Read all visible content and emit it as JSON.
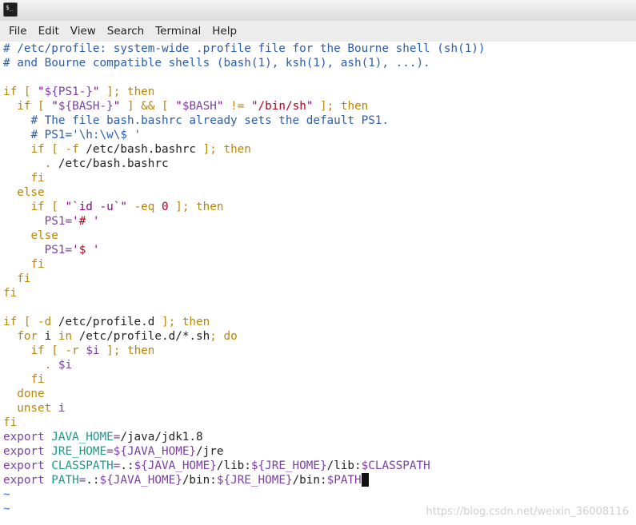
{
  "menu": [
    "File",
    "Edit",
    "View",
    "Search",
    "Terminal",
    "Help"
  ],
  "icon": "terminal-icon",
  "icon_glyph": "$_",
  "lines": [
    [
      [
        "comment",
        "# /etc/profile: system-wide .profile file for the Bourne shell (sh(1))"
      ]
    ],
    [
      [
        "comment",
        "# and Bourne compatible shells (bash(1), ksh(1), ash(1), ...)."
      ]
    ],
    [],
    [
      [
        "keyword",
        "if"
      ],
      [
        "text",
        " "
      ],
      [
        "keyword",
        "["
      ],
      [
        "text",
        " "
      ],
      [
        "string",
        "\""
      ],
      [
        "special",
        "${PS1-}"
      ],
      [
        "string",
        "\""
      ],
      [
        "text",
        " "
      ],
      [
        "keyword",
        "];"
      ],
      [
        "text",
        " "
      ],
      [
        "keyword",
        "then"
      ]
    ],
    [
      [
        "text",
        "  "
      ],
      [
        "keyword",
        "if"
      ],
      [
        "text",
        " "
      ],
      [
        "keyword",
        "["
      ],
      [
        "text",
        " "
      ],
      [
        "string",
        "\""
      ],
      [
        "special",
        "${BASH-}"
      ],
      [
        "string",
        "\""
      ],
      [
        "text",
        " "
      ],
      [
        "keyword",
        "]"
      ],
      [
        "text",
        " "
      ],
      [
        "keyword",
        "&&"
      ],
      [
        "text",
        " "
      ],
      [
        "keyword",
        "["
      ],
      [
        "text",
        " "
      ],
      [
        "string",
        "\""
      ],
      [
        "special",
        "$BASH"
      ],
      [
        "string",
        "\""
      ],
      [
        "text",
        " "
      ],
      [
        "keyword",
        "!="
      ],
      [
        "text",
        " "
      ],
      [
        "string",
        "\""
      ],
      [
        "path",
        "/bin/sh"
      ],
      [
        "string",
        "\""
      ],
      [
        "text",
        " "
      ],
      [
        "keyword",
        "];"
      ],
      [
        "text",
        " "
      ],
      [
        "keyword",
        "then"
      ]
    ],
    [
      [
        "text",
        "    "
      ],
      [
        "comment",
        "# The file bash.bashrc already sets the default PS1."
      ]
    ],
    [
      [
        "text",
        "    "
      ],
      [
        "comment",
        "# PS1='\\h:\\w\\$ '"
      ]
    ],
    [
      [
        "text",
        "    "
      ],
      [
        "keyword",
        "if"
      ],
      [
        "text",
        " "
      ],
      [
        "keyword",
        "["
      ],
      [
        "text",
        " "
      ],
      [
        "keyword",
        "-f"
      ],
      [
        "text",
        " /etc/bash.bashrc "
      ],
      [
        "keyword",
        "];"
      ],
      [
        "text",
        " "
      ],
      [
        "keyword",
        "then"
      ]
    ],
    [
      [
        "text",
        "      "
      ],
      [
        "keyword",
        "."
      ],
      [
        "text",
        " /etc/bash.bashrc"
      ]
    ],
    [
      [
        "text",
        "    "
      ],
      [
        "keyword",
        "fi"
      ]
    ],
    [
      [
        "text",
        "  "
      ],
      [
        "keyword",
        "else"
      ]
    ],
    [
      [
        "text",
        "    "
      ],
      [
        "keyword",
        "if"
      ],
      [
        "text",
        " "
      ],
      [
        "keyword",
        "["
      ],
      [
        "text",
        " "
      ],
      [
        "string",
        "\"`id -u`\""
      ],
      [
        "text",
        " "
      ],
      [
        "keyword",
        "-eq"
      ],
      [
        "text",
        " "
      ],
      [
        "number",
        "0"
      ],
      [
        "text",
        " "
      ],
      [
        "keyword",
        "];"
      ],
      [
        "text",
        " "
      ],
      [
        "keyword",
        "then"
      ]
    ],
    [
      [
        "text",
        "      "
      ],
      [
        "special",
        "PS1="
      ],
      [
        "string",
        "'"
      ],
      [
        "path",
        "#"
      ],
      [
        "string",
        " '"
      ]
    ],
    [
      [
        "text",
        "    "
      ],
      [
        "keyword",
        "else"
      ]
    ],
    [
      [
        "text",
        "      "
      ],
      [
        "special",
        "PS1="
      ],
      [
        "string",
        "'"
      ],
      [
        "path",
        "$"
      ],
      [
        "string",
        " '"
      ]
    ],
    [
      [
        "text",
        "    "
      ],
      [
        "keyword",
        "fi"
      ]
    ],
    [
      [
        "text",
        "  "
      ],
      [
        "keyword",
        "fi"
      ]
    ],
    [
      [
        "keyword",
        "fi"
      ]
    ],
    [],
    [
      [
        "keyword",
        "if"
      ],
      [
        "text",
        " "
      ],
      [
        "keyword",
        "["
      ],
      [
        "text",
        " "
      ],
      [
        "keyword",
        "-d"
      ],
      [
        "text",
        " /etc/profile.d "
      ],
      [
        "keyword",
        "];"
      ],
      [
        "text",
        " "
      ],
      [
        "keyword",
        "then"
      ]
    ],
    [
      [
        "text",
        "  "
      ],
      [
        "keyword",
        "for"
      ],
      [
        "text",
        " i "
      ],
      [
        "keyword",
        "in"
      ],
      [
        "text",
        " /etc/profile.d/*.sh"
      ],
      [
        "keyword",
        ";"
      ],
      [
        "text",
        " "
      ],
      [
        "keyword",
        "do"
      ]
    ],
    [
      [
        "text",
        "    "
      ],
      [
        "keyword",
        "if"
      ],
      [
        "text",
        " "
      ],
      [
        "keyword",
        "["
      ],
      [
        "text",
        " "
      ],
      [
        "keyword",
        "-r"
      ],
      [
        "text",
        " "
      ],
      [
        "special",
        "$i"
      ],
      [
        "text",
        " "
      ],
      [
        "keyword",
        "];"
      ],
      [
        "text",
        " "
      ],
      [
        "keyword",
        "then"
      ]
    ],
    [
      [
        "text",
        "      "
      ],
      [
        "keyword",
        "."
      ],
      [
        "text",
        " "
      ],
      [
        "special",
        "$i"
      ]
    ],
    [
      [
        "text",
        "    "
      ],
      [
        "keyword",
        "fi"
      ]
    ],
    [
      [
        "text",
        "  "
      ],
      [
        "keyword",
        "done"
      ]
    ],
    [
      [
        "text",
        "  "
      ],
      [
        "keyword",
        "unset"
      ],
      [
        "text",
        " "
      ],
      [
        "special",
        "i"
      ]
    ],
    [
      [
        "keyword",
        "fi"
      ]
    ],
    [
      [
        "special",
        "export"
      ],
      [
        "text",
        " "
      ],
      [
        "ident",
        "JAVA_HOME"
      ],
      [
        "special",
        "="
      ],
      [
        "text",
        "/java/jdk1.8"
      ]
    ],
    [
      [
        "special",
        "export"
      ],
      [
        "text",
        " "
      ],
      [
        "ident",
        "JRE_HOME"
      ],
      [
        "special",
        "="
      ],
      [
        "special",
        "${JAVA_HOME}"
      ],
      [
        "text",
        "/jre"
      ]
    ],
    [
      [
        "special",
        "export"
      ],
      [
        "text",
        " "
      ],
      [
        "ident",
        "CLASSPATH"
      ],
      [
        "special",
        "="
      ],
      [
        "text",
        ".:"
      ],
      [
        "special",
        "${JAVA_HOME}"
      ],
      [
        "text",
        "/lib:"
      ],
      [
        "special",
        "${JRE_HOME}"
      ],
      [
        "text",
        "/lib:"
      ],
      [
        "special",
        "$CLASSPATH"
      ]
    ],
    [
      [
        "special",
        "export"
      ],
      [
        "text",
        " "
      ],
      [
        "ident",
        "PATH"
      ],
      [
        "special",
        "="
      ],
      [
        "text",
        ".:"
      ],
      [
        "special",
        "${JAVA_HOME}"
      ],
      [
        "text",
        "/bin:"
      ],
      [
        "special",
        "${JRE_HOME}"
      ],
      [
        "text",
        "/bin:"
      ],
      [
        "special",
        "$PATH"
      ],
      [
        "cursor",
        ""
      ]
    ],
    [
      [
        "tilde",
        "~"
      ]
    ],
    [
      [
        "tilde",
        "~"
      ]
    ]
  ],
  "watermark": "https://blog.csdn.net/weixin_36008116"
}
